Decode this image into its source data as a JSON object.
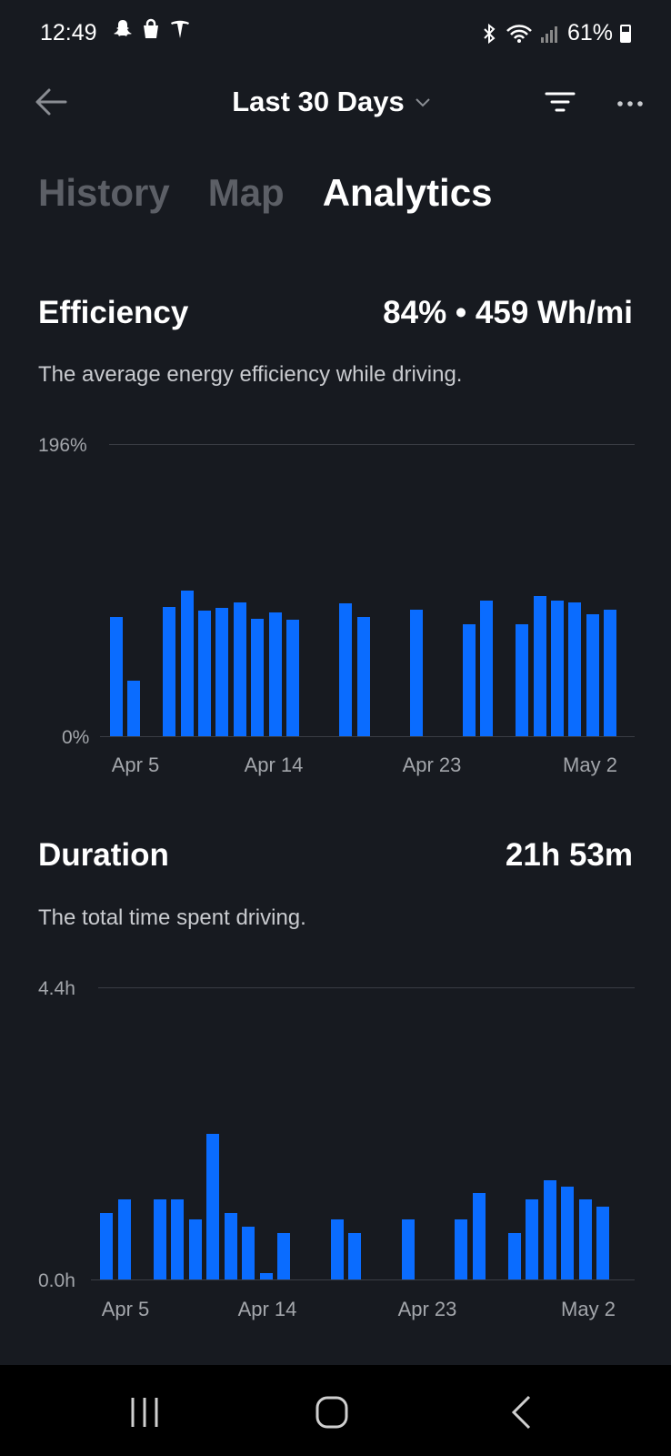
{
  "status_bar": {
    "time": "12:49",
    "battery": "61%"
  },
  "header": {
    "range_label": "Last 30 Days"
  },
  "tabs": [
    {
      "label": "History",
      "active": false
    },
    {
      "label": "Map",
      "active": false
    },
    {
      "label": "Analytics",
      "active": true
    }
  ],
  "efficiency": {
    "title": "Efficiency",
    "summary": "84% • 459 Wh/mi",
    "description": "The average energy efficiency while driving.",
    "y_max_label": "196%",
    "y_min_label": "0%"
  },
  "duration": {
    "title": "Duration",
    "summary": "21h 53m",
    "description": "The total time spent driving.",
    "y_max_label": "4.4h",
    "y_min_label": "0.0h"
  },
  "accent_color": "#0a6cff",
  "chart_data": [
    {
      "type": "bar",
      "ylim": [
        0,
        196
      ],
      "x_ticks": [
        "Apr 5",
        "Apr 14",
        "Apr 23",
        "May 2"
      ],
      "categories": [
        "Apr 5",
        "Apr 6",
        "Apr 7",
        "Apr 8",
        "Apr 9",
        "Apr 10",
        "Apr 11",
        "Apr 12",
        "Apr 13",
        "Apr 14",
        "Apr 15",
        "Apr 16",
        "Apr 17",
        "Apr 18",
        "Apr 19",
        "Apr 20",
        "Apr 21",
        "Apr 22",
        "Apr 23",
        "Apr 24",
        "Apr 25",
        "Apr 26",
        "Apr 27",
        "Apr 28",
        "Apr 29",
        "Apr 30",
        "May 1",
        "May 2",
        "May 3"
      ],
      "values": [
        80,
        37,
        0,
        87,
        98,
        84,
        86,
        90,
        79,
        83,
        78,
        0,
        0,
        89,
        80,
        0,
        0,
        85,
        0,
        0,
        75,
        91,
        0,
        75,
        94,
        91,
        90,
        82,
        85
      ]
    },
    {
      "type": "bar",
      "ylim": [
        0,
        4.4
      ],
      "x_ticks": [
        "Apr 5",
        "Apr 14",
        "Apr 23",
        "May 2"
      ],
      "categories": [
        "Apr 4",
        "Apr 5",
        "Apr 6",
        "Apr 7",
        "Apr 8",
        "Apr 9",
        "Apr 10",
        "Apr 11",
        "Apr 12",
        "Apr 13",
        "Apr 14",
        "Apr 15",
        "Apr 16",
        "Apr 17",
        "Apr 18",
        "Apr 19",
        "Apr 20",
        "Apr 21",
        "Apr 22",
        "Apr 23",
        "Apr 24",
        "Apr 25",
        "Apr 26",
        "Apr 27",
        "Apr 28",
        "Apr 29",
        "Apr 30",
        "May 1",
        "May 2",
        "May 3"
      ],
      "values": [
        1.0,
        1.2,
        0,
        1.2,
        1.2,
        0.9,
        2.2,
        1.0,
        0.8,
        0.1,
        0.7,
        0,
        0,
        0.9,
        0.7,
        0,
        0,
        0.9,
        0,
        0,
        0.9,
        1.3,
        0,
        0.7,
        1.2,
        1.5,
        1.4,
        1.2,
        1.1,
        0
      ]
    }
  ]
}
